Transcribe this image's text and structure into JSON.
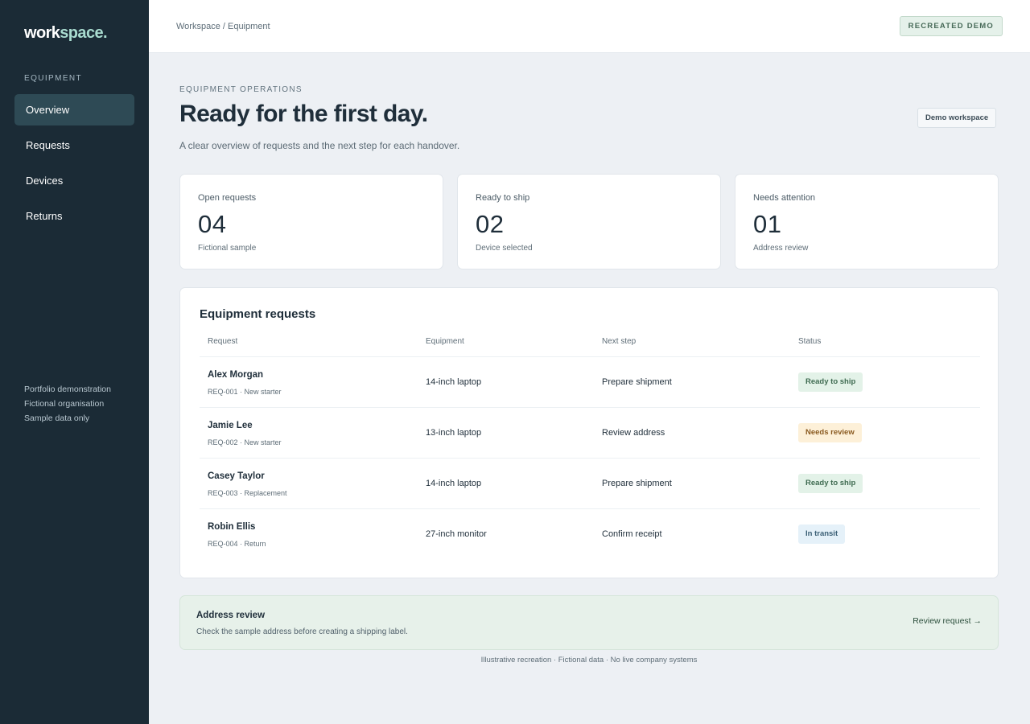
{
  "brand": {
    "part1": "work",
    "part2": "space."
  },
  "sidebar": {
    "section_label": "EQUIPMENT",
    "items": [
      {
        "label": "Overview",
        "active": true
      },
      {
        "label": "Requests",
        "active": false
      },
      {
        "label": "Devices",
        "active": false
      },
      {
        "label": "Returns",
        "active": false
      }
    ],
    "footer": [
      "Portfolio demonstration",
      "Fictional organisation",
      "Sample data only"
    ]
  },
  "topbar": {
    "breadcrumb": "Workspace / Equipment",
    "tag": "RECREATED DEMO"
  },
  "header": {
    "eyebrow": "EQUIPMENT OPERATIONS",
    "title": "Ready for the first day.",
    "subtitle": "A clear overview of requests and the next step for each handover.",
    "workspace_label": "Demo workspace"
  },
  "stats": [
    {
      "label": "Open requests",
      "value": "04",
      "note": "Fictional sample"
    },
    {
      "label": "Ready to ship",
      "value": "02",
      "note": "Device selected"
    },
    {
      "label": "Needs attention",
      "value": "01",
      "note": "Address review"
    }
  ],
  "requests": {
    "title": "Equipment requests",
    "columns": [
      "Request",
      "Equipment",
      "Next step",
      "Status"
    ],
    "rows": [
      {
        "name": "Alex Morgan",
        "meta": "REQ-001 · New starter",
        "equipment": "14-inch laptop",
        "next_step": "Prepare shipment",
        "status": "Ready to ship",
        "status_type": "ready"
      },
      {
        "name": "Jamie Lee",
        "meta": "REQ-002 · New starter",
        "equipment": "13-inch laptop",
        "next_step": "Review address",
        "status": "Needs review",
        "status_type": "review"
      },
      {
        "name": "Casey Taylor",
        "meta": "REQ-003 · Replacement",
        "equipment": "14-inch laptop",
        "next_step": "Prepare shipment",
        "status": "Ready to ship",
        "status_type": "ready"
      },
      {
        "name": "Robin Ellis",
        "meta": "REQ-004 · Return",
        "equipment": "27-inch monitor",
        "next_step": "Confirm receipt",
        "status": "In transit",
        "status_type": "transit"
      }
    ]
  },
  "alert": {
    "title": "Address review",
    "text": "Check the sample address before creating a shipping label.",
    "link": "Review request →"
  },
  "footer": "Illustrative recreation · Fictional data · No live company systems",
  "colors": {
    "sidebar_bg": "#1b2b36",
    "sidebar_active": "#2e4a55",
    "brand_accent": "#a9dcd0",
    "page_bg": "#edf0f4",
    "status_ready": "#e3f2e8",
    "status_review": "#fdf0d8",
    "status_transit": "#e5f1f9"
  }
}
